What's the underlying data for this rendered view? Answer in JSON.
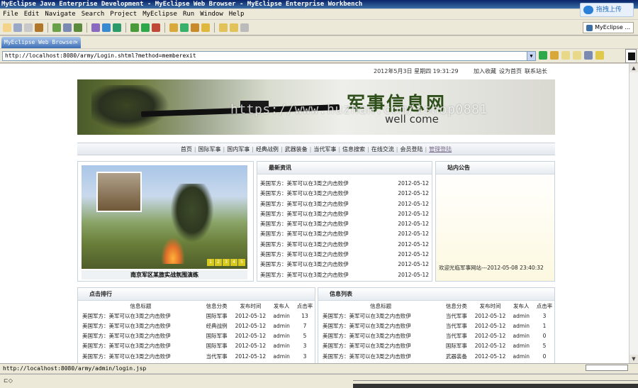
{
  "window": {
    "title": "MyEclipse Java Enterprise Development - MyEclipse Web Browser - MyEclipse Enterprise Workbench",
    "cloud_upload": "拖拽上传",
    "menu": [
      "File",
      "Edit",
      "Navigate",
      "Search",
      "Project",
      "MyEclipse",
      "Run",
      "Window",
      "Help"
    ],
    "perspective": "MyEclipse ...",
    "tab_label": "MyEclipse Web Browser"
  },
  "browser": {
    "url": "http://localhost:8080/army/Login.shtml?method=memberexit",
    "status_url": "http://localhost:8080/army/admin/login.jsp"
  },
  "page": {
    "datetime": "2012年5月3日  星期四  19:31:29",
    "top_links": [
      "加入收藏",
      "设为首页",
      "联系站长"
    ],
    "banner_title": "军事信息网",
    "banner_sub": "well come",
    "watermark": "https://www.huzhan.com/ishop0881",
    "nav": [
      "首页",
      "国际军事",
      "国内军事",
      "经典战例",
      "武器装备",
      "当代军事",
      "信息搜索",
      "在线交流",
      "会员登陆",
      "管理登陆"
    ],
    "photo_caption": "南京军区某旅实战氛围演练",
    "photo_pager": [
      "1",
      "2",
      "3",
      "4",
      "5"
    ],
    "latest_news": {
      "title": "最新资讯",
      "items": [
        {
          "title": "美国军方：美军可以在3周之内击败伊",
          "date": "2012-05-12"
        },
        {
          "title": "美国军方：美军可以在3周之内击败伊",
          "date": "2012-05-12"
        },
        {
          "title": "美国军方：美军可以在3周之内击败伊",
          "date": "2012-05-12"
        },
        {
          "title": "美国军方：美军可以在3周之内击败伊",
          "date": "2012-05-12"
        },
        {
          "title": "美国军方：美军可以在3周之内击败伊",
          "date": "2012-05-12"
        },
        {
          "title": "美国军方：美军可以在3周之内击败伊",
          "date": "2012-05-12"
        },
        {
          "title": "美国军方：美军可以在3周之内击败伊",
          "date": "2012-05-12"
        },
        {
          "title": "美国军方：美军可以在3周之内击败伊",
          "date": "2012-05-12"
        },
        {
          "title": "美国军方：美军可以在3周之内击败伊",
          "date": "2012-05-12"
        },
        {
          "title": "美国军方：美军可以在3周之内击败伊",
          "date": "2012-05-12"
        }
      ]
    },
    "notice": {
      "title": "站内公告",
      "text": "欢迎光临军事网站---2012-05-08 23:40:32"
    },
    "ranking": {
      "title": "点击排行",
      "headers": [
        "信息标题",
        "信息分类",
        "发布时间",
        "发布人",
        "点击率"
      ],
      "rows": [
        [
          "美国军方：美军可以在3周之内击败伊",
          "国际军事",
          "2012-05-12",
          "admin",
          "13"
        ],
        [
          "美国军方：美军可以在3周之内击败伊",
          "经典战例",
          "2012-05-12",
          "admin",
          "7"
        ],
        [
          "美国军方：美军可以在3周之内击败伊",
          "国际军事",
          "2012-05-12",
          "admin",
          "5"
        ],
        [
          "美国军方：美军可以在3周之内击败伊",
          "国际军事",
          "2012-05-12",
          "admin",
          "3"
        ],
        [
          "美国军方：美军可以在3周之内击败伊",
          "当代军事",
          "2012-05-12",
          "admin",
          "3"
        ]
      ]
    },
    "info_list": {
      "title": "信息列表",
      "headers": [
        "信息标题",
        "信息分类",
        "发布时间",
        "发布人",
        "点击率"
      ],
      "rows": [
        [
          "美国军方：美军可以在3周之内击败伊",
          "当代军事",
          "2012-05-12",
          "admin",
          "3"
        ],
        [
          "美国军方：美军可以在3周之内击败伊",
          "当代军事",
          "2012-05-12",
          "admin",
          "1"
        ],
        [
          "美国军方：美军可以在3周之内击败伊",
          "当代军事",
          "2012-05-12",
          "admin",
          "0"
        ],
        [
          "美国军方：美军可以在3周之内击败伊",
          "国际军事",
          "2012-05-12",
          "admin",
          "5"
        ],
        [
          "美国军方：美军可以在3周之内击败伊",
          "武器装备",
          "2012-05-12",
          "admin",
          "0"
        ]
      ]
    }
  }
}
